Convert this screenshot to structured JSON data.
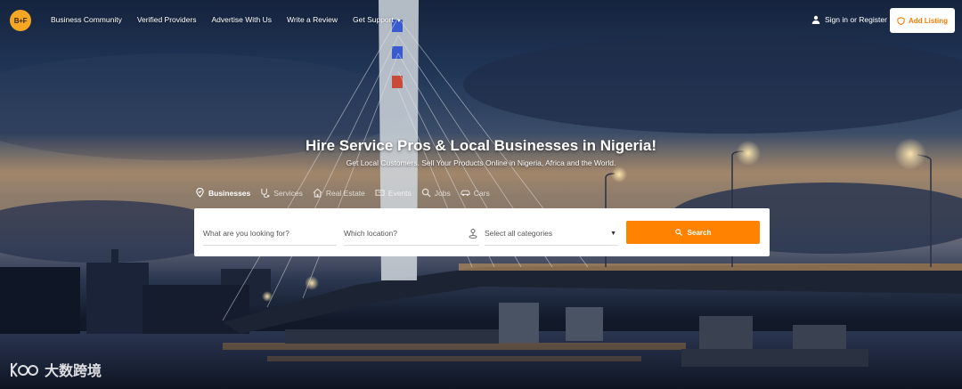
{
  "brand": {
    "logo_text": "B+F",
    "accent": "#ff8200",
    "logo_color": "#f5a623"
  },
  "nav": {
    "links": [
      {
        "label": "Business Community"
      },
      {
        "label": "Verified Providers"
      },
      {
        "label": "Advertise With Us"
      },
      {
        "label": "Write a Review"
      },
      {
        "label": "Get Support",
        "has_caret": true
      }
    ],
    "signin_label": "Sign in or Register",
    "add_listing_label": "Add Listing"
  },
  "hero": {
    "title": "Hire Service Pros & Local Businesses in Nigeria!",
    "subtitle": "Get Local Customers. Sell Your Products Online in Nigeria, Africa and the World."
  },
  "tabs": [
    {
      "label": "Businesses",
      "icon": "map-pin-icon",
      "active": true
    },
    {
      "label": "Services",
      "icon": "stethoscope-icon",
      "active": false
    },
    {
      "label": "Real Estate",
      "icon": "house-icon",
      "active": false
    },
    {
      "label": "Events",
      "icon": "ticket-icon",
      "active": false
    },
    {
      "label": "Jobs",
      "icon": "search-icon",
      "active": false
    },
    {
      "label": "Cars",
      "icon": "car-icon",
      "active": false
    }
  ],
  "search": {
    "what_placeholder": "What are you looking for?",
    "where_placeholder": "Which location?",
    "category_selected": "Select all categories",
    "button_label": "Search"
  },
  "watermark": {
    "text": "大数跨境"
  }
}
